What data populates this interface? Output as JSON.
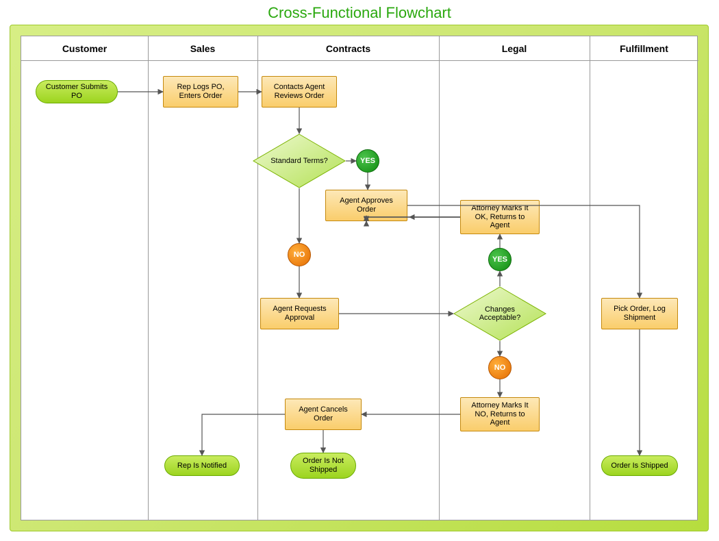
{
  "title": "Cross-Functional Flowchart",
  "lanes": {
    "customer": "Customer",
    "sales": "Sales",
    "contracts": "Contracts",
    "legal": "Legal",
    "fulfillment": "Fulfillment"
  },
  "nodes": {
    "customer_submits_po": "Customer Submits PO",
    "rep_logs_po": "Rep Logs PO, Enters Order",
    "contacts_agent_reviews": "Contacts Agent Reviews Order",
    "standard_terms": "Standard Terms?",
    "yes1": "YES",
    "agent_approves": "Agent Approves Order",
    "no1": "NO",
    "agent_requests_approval": "Agent Requests Approval",
    "changes_acceptable": "Changes Acceptable?",
    "yes2": "YES",
    "attorney_ok": "Attorney Marks It OK, Returns to Agent",
    "no2": "NO",
    "attorney_no": "Attorney Marks It NO, Returns to Agent",
    "agent_cancels": "Agent Cancels Order",
    "rep_notified": "Rep Is Notified",
    "order_not_shipped": "Order Is Not Shipped",
    "pick_order": "Pick Order, Log Shipment",
    "order_shipped": "Order Is Shipped"
  }
}
